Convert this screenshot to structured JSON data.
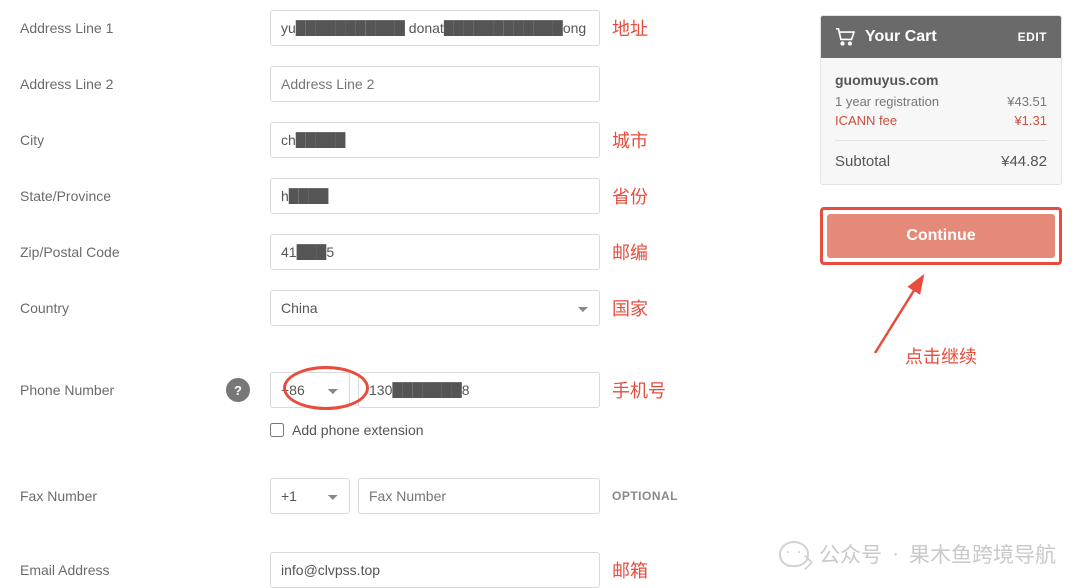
{
  "form": {
    "address1": {
      "label": "Address Line 1",
      "value": "yu███████████ donat████████████ong",
      "anno": "地址"
    },
    "address2": {
      "label": "Address Line 2",
      "placeholder": "Address Line 2"
    },
    "city": {
      "label": "City",
      "value": "ch█████",
      "anno": "城市"
    },
    "state": {
      "label": "State/Province",
      "value": "h████",
      "anno": "省份"
    },
    "zip": {
      "label": "Zip/Postal Code",
      "value": "41███5",
      "anno": "邮编"
    },
    "country": {
      "label": "Country",
      "selected": "China",
      "anno": "国家"
    },
    "phone": {
      "label": "Phone Number",
      "cc": "+86",
      "value": "130███████8",
      "anno": "手机号",
      "help": "?"
    },
    "add_ext": {
      "label": "Add phone extension"
    },
    "fax": {
      "label": "Fax Number",
      "cc": "+1",
      "placeholder": "Fax Number",
      "optional": "OPTIONAL"
    },
    "email": {
      "label": "Email Address",
      "value": "info@clvpss.top",
      "anno": "邮箱"
    }
  },
  "cart": {
    "title": "Your Cart",
    "edit": "EDIT",
    "domain": "guomuyus.com",
    "reg_label": "1 year registration",
    "reg_price": "¥43.51",
    "fee_label": "ICANN fee",
    "fee_price": "¥1.31",
    "subtotal_label": "Subtotal",
    "subtotal_price": "¥44.82",
    "continue": "Continue",
    "click_anno": "点击继续"
  },
  "watermark": {
    "prefix": "公众号",
    "dot": "·",
    "name": "果木鱼跨境导航"
  }
}
